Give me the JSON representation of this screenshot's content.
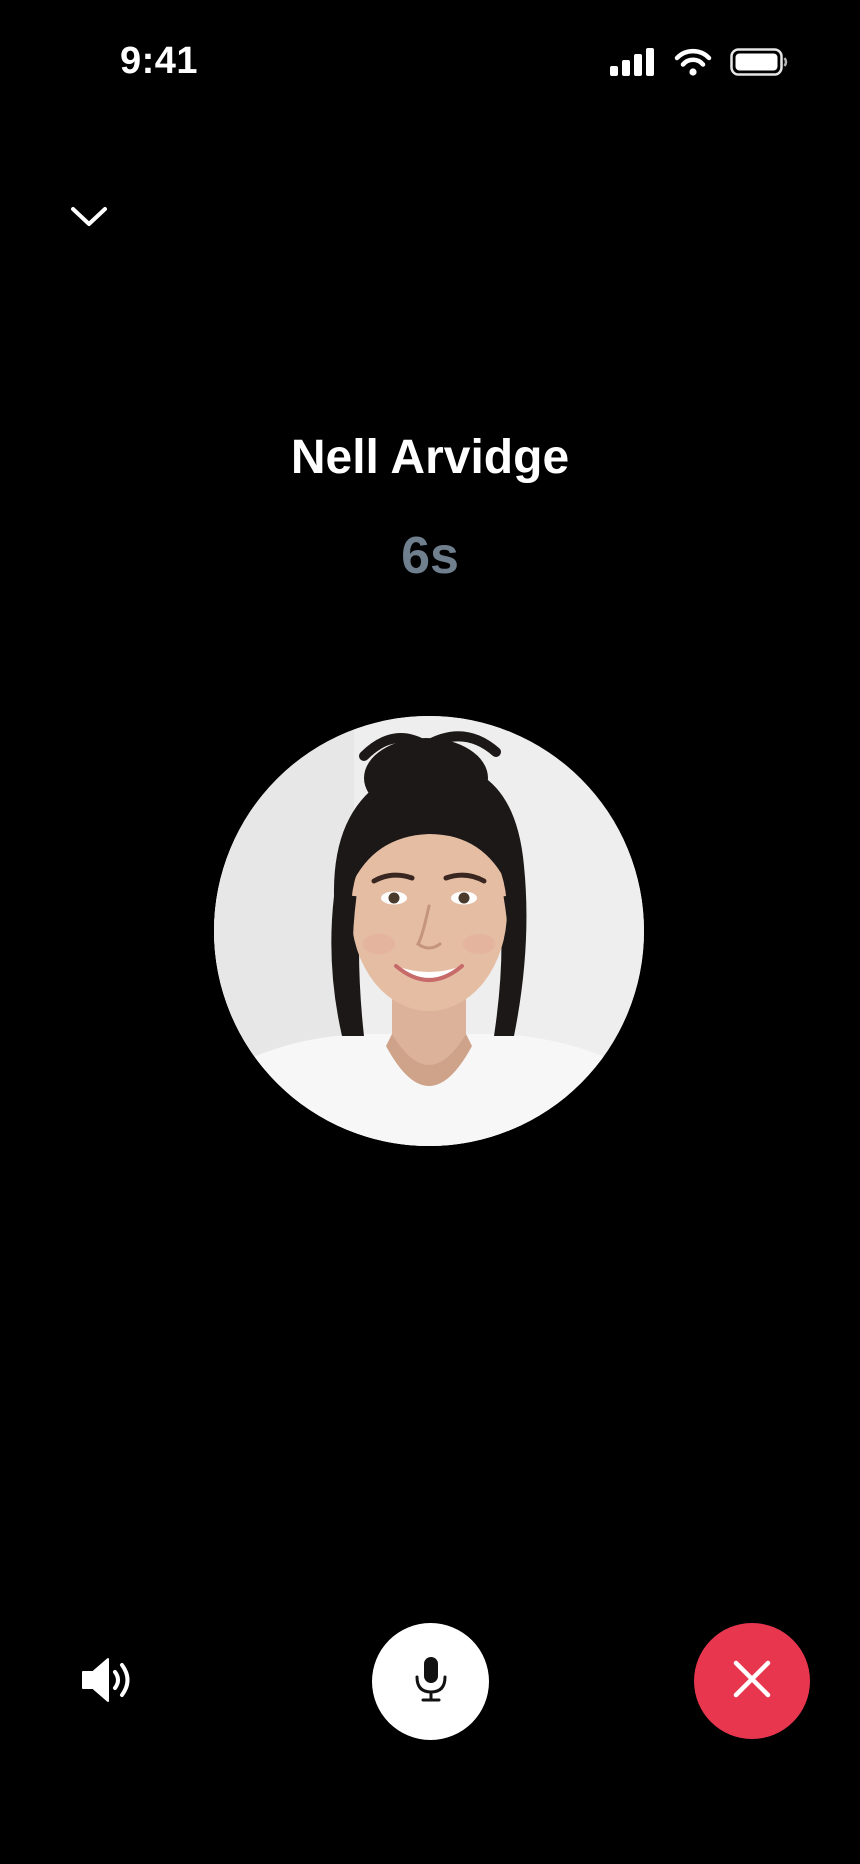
{
  "status_bar": {
    "time": "9:41",
    "icons": [
      "cellular-signal-icon",
      "wifi-icon",
      "battery-icon"
    ]
  },
  "header": {
    "collapse_icon": "chevron-down-icon"
  },
  "caller": {
    "name": "Nell Arvidge",
    "duration": "6s"
  },
  "controls": {
    "speaker_icon": "speaker-icon",
    "mic_icon": "microphone-icon",
    "end_call_icon": "close-icon"
  },
  "colors": {
    "background": "#000000",
    "text_primary": "#ffffff",
    "duration_text": "#6f7f8e",
    "end_call": "#e8364f",
    "mic_button": "#ffffff"
  }
}
